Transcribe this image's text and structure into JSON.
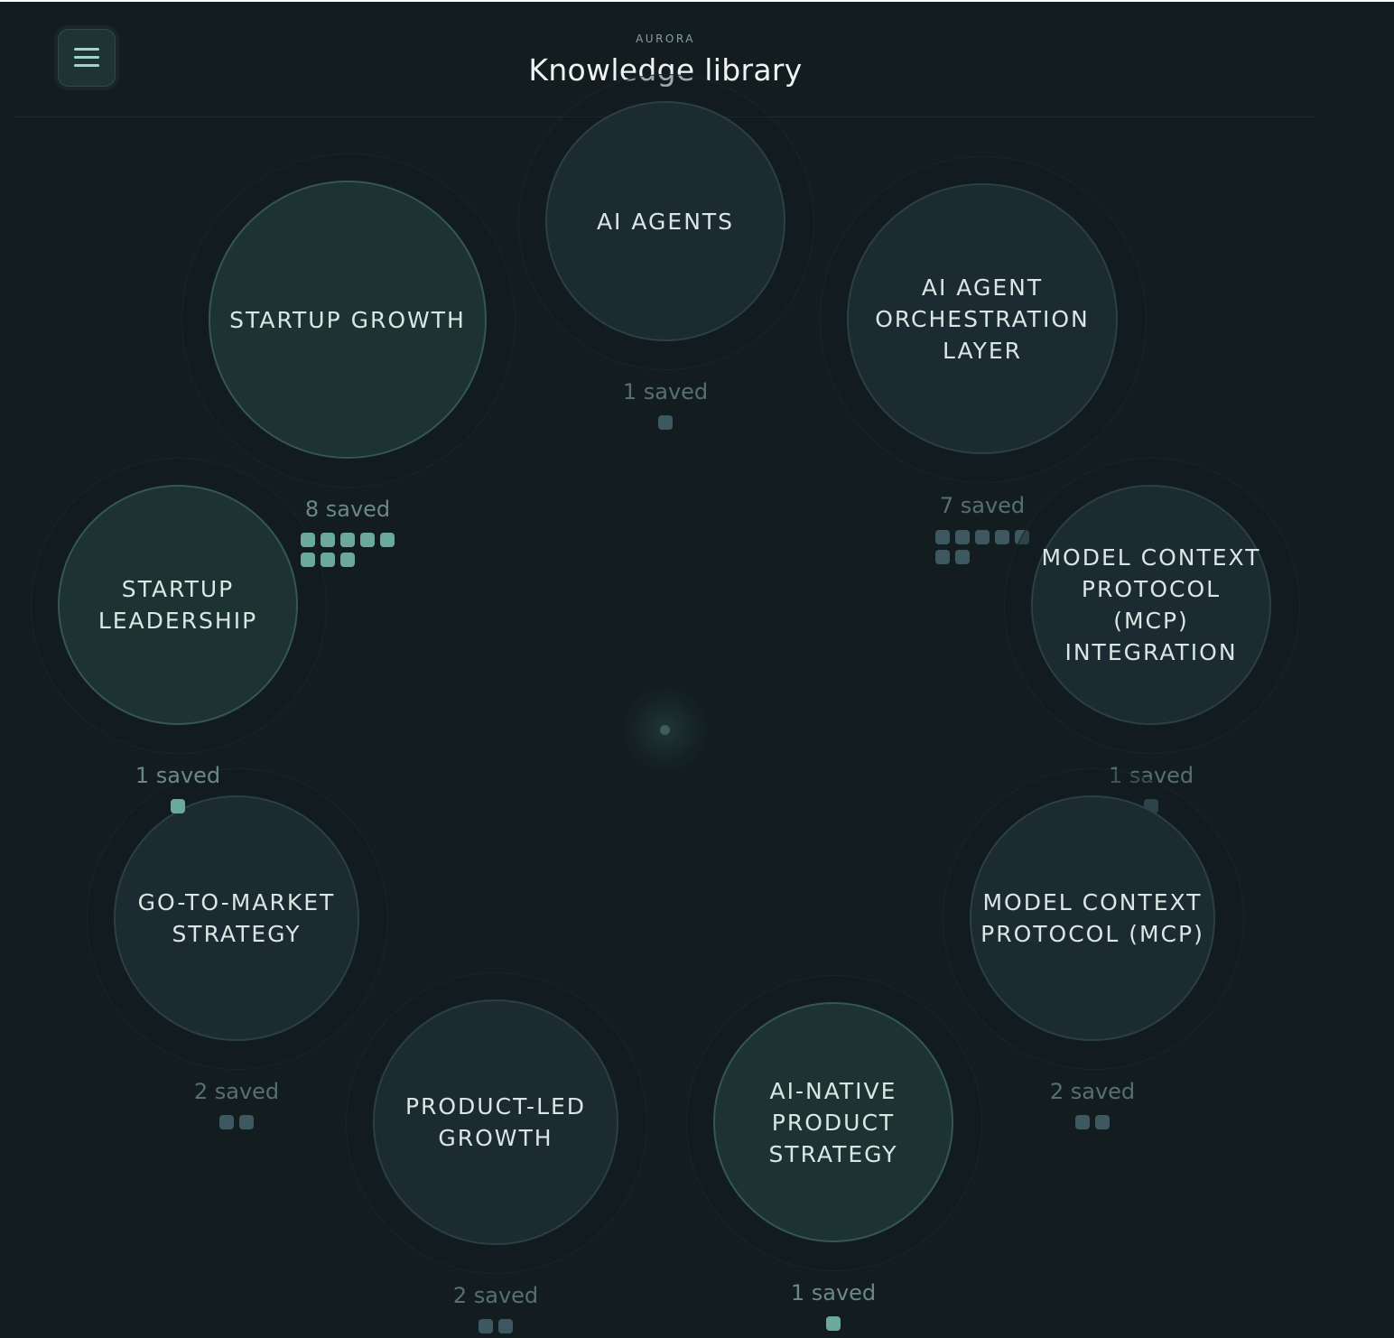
{
  "header": {
    "app_name": "AURORA",
    "title": "Knowledge library",
    "menu_icon": "hamburger-icon"
  },
  "topics": [
    {
      "label": "AI AGENTS",
      "count_label": "1 saved",
      "saved": 1,
      "tone": "slate"
    },
    {
      "label": "AI AGENT ORCHESTRATION LAYER",
      "count_label": "7 saved",
      "saved": 7,
      "tone": "slate"
    },
    {
      "label": "MODEL CONTEXT PROTOCOL (MCP) INTEGRATION",
      "count_label": "1 saved",
      "saved": 1,
      "tone": "slate"
    },
    {
      "label": "MODEL CONTEXT PROTOCOL (MCP)",
      "count_label": "2 saved",
      "saved": 2,
      "tone": "slate"
    },
    {
      "label": "AI-NATIVE PRODUCT STRATEGY",
      "count_label": "1 saved",
      "saved": 1,
      "tone": "teal"
    },
    {
      "label": "PRODUCT-LED GROWTH",
      "count_label": "2 saved",
      "saved": 2,
      "tone": "slate"
    },
    {
      "label": "GO-TO-MARKET STRATEGY",
      "count_label": "2 saved",
      "saved": 2,
      "tone": "slate"
    },
    {
      "label": "STARTUP LEADERSHIP",
      "count_label": "1 saved",
      "saved": 1,
      "tone": "teal"
    },
    {
      "label": "STARTUP GROWTH",
      "count_label": "8 saved",
      "saved": 8,
      "tone": "teal"
    }
  ],
  "topic_lines": {
    "t0": [
      "AI AGENTS"
    ],
    "t1": [
      "AI AGENT",
      "ORCHESTRATION",
      "LAYER"
    ],
    "t2": [
      "MODEL CONTEXT",
      "PROTOCOL",
      "(MCP)",
      "INTEGRATION"
    ],
    "t3": [
      "MODEL CONTEXT",
      "PROTOCOL (MCP)"
    ],
    "t4": [
      "AI-NATIVE",
      "PRODUCT",
      "STRATEGY"
    ],
    "t5": [
      "PRODUCT-LED",
      "GROWTH"
    ],
    "t6": [
      "GO-TO-MARKET",
      "STRATEGY"
    ],
    "t7": [
      "STARTUP",
      "LEADERSHIP"
    ],
    "t8": [
      "STARTUP GROWTH"
    ]
  },
  "colors": {
    "background": "#131d20",
    "bubble_slate": "#1c2a31",
    "bubble_teal": "#1d3332",
    "dot_slate": "#3d5860",
    "dot_teal": "#6aa99c",
    "accent": "#9fd6cb"
  }
}
